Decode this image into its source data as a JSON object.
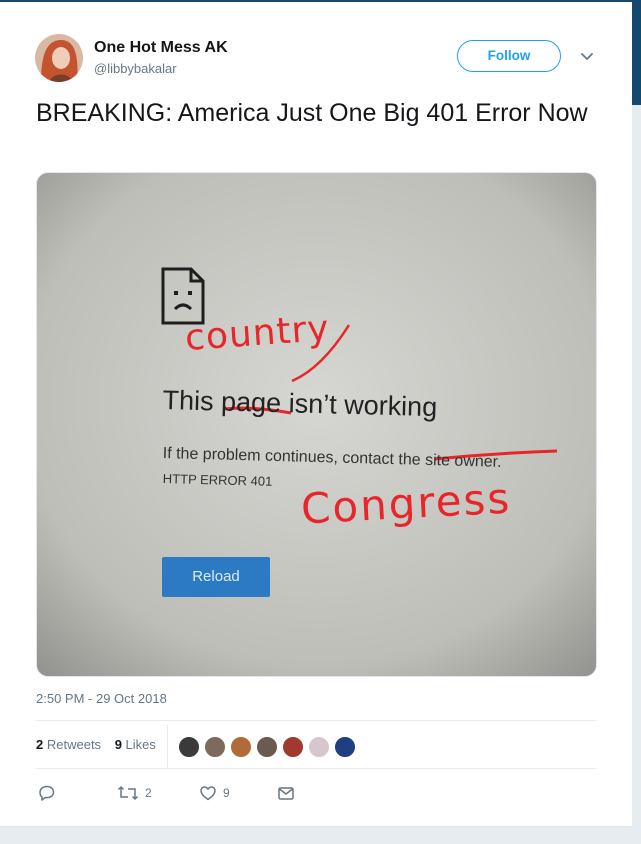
{
  "author": {
    "name": "One Hot Mess AK",
    "handle": "@libbybakalar"
  },
  "follow_label": "Follow",
  "tweet_text": "BREAKING: America Just One Big 401 Error Now",
  "photo": {
    "title_words": [
      "This",
      "page",
      "isn’t working"
    ],
    "body_text": "If the problem continues, contact",
    "body_struck": "the site owner.",
    "error_code": "HTTP ERROR 401",
    "reload_label": "Reload",
    "handwriting_1": "country",
    "handwriting_2": "Congress"
  },
  "timestamp": "2:50 PM - 29 Oct 2018",
  "stats": {
    "retweets_count": "2",
    "retweets_label": "Retweets",
    "likes_count": "9",
    "likes_label": "Likes"
  },
  "likers": [
    "#3a3a3a",
    "#7d6a5c",
    "#b06b3a",
    "#6b5a4e",
    "#a03a2e",
    "#d8c6cf",
    "#1f3f80"
  ],
  "actions": {
    "reply_icon": "reply-icon",
    "retweet_icon": "retweet-icon",
    "retweet_count": "2",
    "like_icon": "heart-icon",
    "like_count": "9",
    "dm_icon": "envelope-icon"
  },
  "colors": {
    "accent": "#1da1f2",
    "muted": "#657786",
    "handwriting": "#e8262a"
  }
}
